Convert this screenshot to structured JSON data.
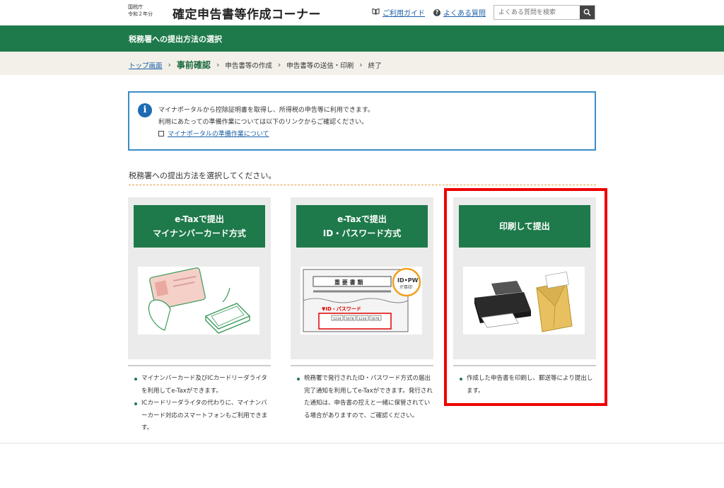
{
  "header": {
    "agency_line1": "国税庁",
    "agency_line2": "令和２年分",
    "site_title": "確定申告書等作成コーナー",
    "guide_link": "ご利用ガイド",
    "faq_link": "よくある質問",
    "search_placeholder": "よくある質問を検索"
  },
  "page_title": "税務署への提出方法の選択",
  "breadcrumb": {
    "items": [
      "トップ画面",
      "事前確認",
      "申告書等の作成",
      "申告書等の送信・印刷",
      "終了"
    ]
  },
  "info": {
    "line1": "マイナポータルから控除証明書を取得し、所得税の申告等に利用できます。",
    "line2": "利用にあたっての準備作業については以下のリンクからご確認ください。",
    "link": "マイナポータルの準備作業について"
  },
  "prompt": "税務署への提出方法を選択してください。",
  "cards": [
    {
      "title_line1": "e-Taxで提出",
      "title_line2": "マイナンバーカード方式",
      "bullets": [
        "マイナンバーカード及びICカードリーダライタを利用してe-Taxができます。",
        "ICカードリーダライタの代わりに、マイナンバーカード対応のスマートフォンもご利用できます。"
      ]
    },
    {
      "title_line1": "e-Taxで提出",
      "title_line2": "ID・パスワード方式",
      "bullets": [
        "税務署で発行されたID・パスワード方式の届出完了通知を利用してe-Taxができます。発行された通知は、申告書の控えと一緒に保管されている場合がありますので、ご確認ください。"
      ],
      "image_text": {
        "doc_title": "重 要 書 類",
        "badge_line1": "ID•PW",
        "badge_line2": "が目印",
        "id_label": "▼ID・パスワード",
        "nums": [
          "1234",
          "5678",
          "1234",
          "5678"
        ]
      }
    },
    {
      "title_line1": "印刷して提出",
      "bullets": [
        "作成した申告書を印刷し、郵送等により提出します。"
      ]
    }
  ],
  "colors": {
    "green": "#1e7a4a",
    "highlight": "#ee0000",
    "link": "#1a5fa8",
    "info_border": "#3b8ec8"
  },
  "icons": [
    "book-icon",
    "faq-icon",
    "search-icon",
    "info-icon",
    "document-icon"
  ]
}
